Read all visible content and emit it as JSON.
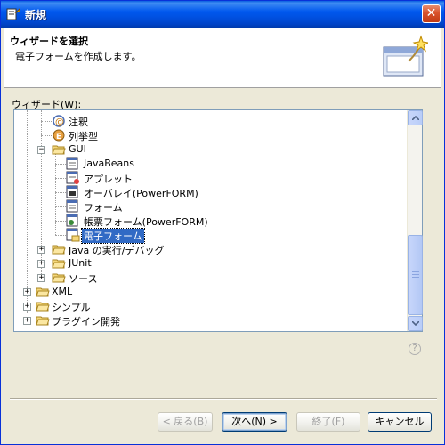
{
  "window": {
    "title": "新規"
  },
  "header": {
    "title": "ウィザードを選択",
    "description": "電子フォームを作成します。"
  },
  "list_label": "ウィザード(W):",
  "tree": {
    "items": [
      {
        "label": "注釈"
      },
      {
        "label": "列挙型"
      },
      {
        "label": "GUI"
      },
      {
        "label": "JavaBeans"
      },
      {
        "label": "アプレット"
      },
      {
        "label": "オーバレイ(PowerFORM)"
      },
      {
        "label": "フォーム"
      },
      {
        "label": "帳票フォーム(PowerFORM)"
      },
      {
        "label": "電子フォーム"
      },
      {
        "label": "Java の実行/デバッグ"
      },
      {
        "label": "JUnit"
      },
      {
        "label": "ソース"
      },
      {
        "label": "XML"
      },
      {
        "label": "シンプル"
      },
      {
        "label": "プラグイン開発"
      }
    ]
  },
  "buttons": {
    "back": "< 戻る(B)",
    "next": "次へ(N) >",
    "finish": "終了(F)",
    "cancel": "キャンセル"
  },
  "colors": {
    "selection": "#316ac5",
    "titlebar": "#0058ee"
  }
}
